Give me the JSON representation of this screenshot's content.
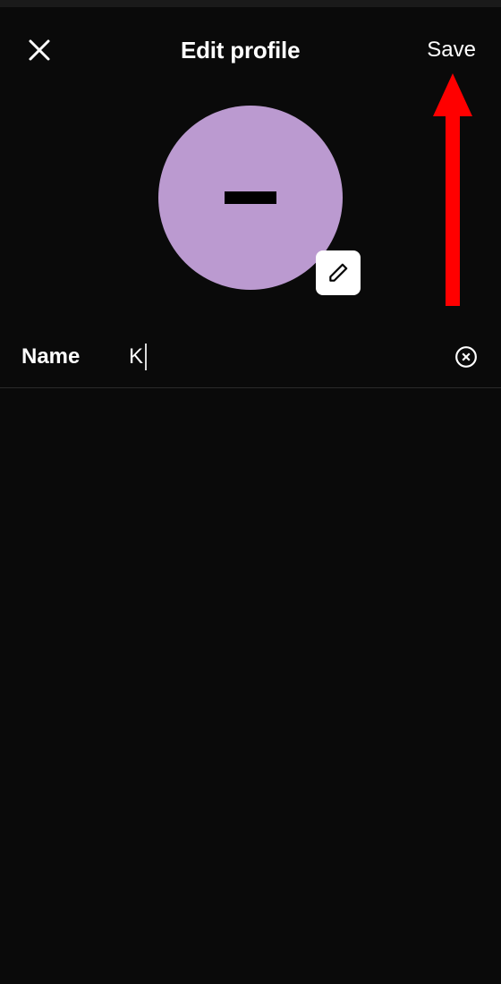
{
  "header": {
    "title": "Edit profile",
    "save_label": "Save"
  },
  "avatar": {
    "background_color": "#bb9ad0",
    "icon": "dash-icon",
    "edit_icon": "pencil-icon"
  },
  "form": {
    "name_label": "Name",
    "name_value": "K"
  },
  "annotation": {
    "arrow_color": "#ff0000",
    "points_to": "save-button"
  }
}
